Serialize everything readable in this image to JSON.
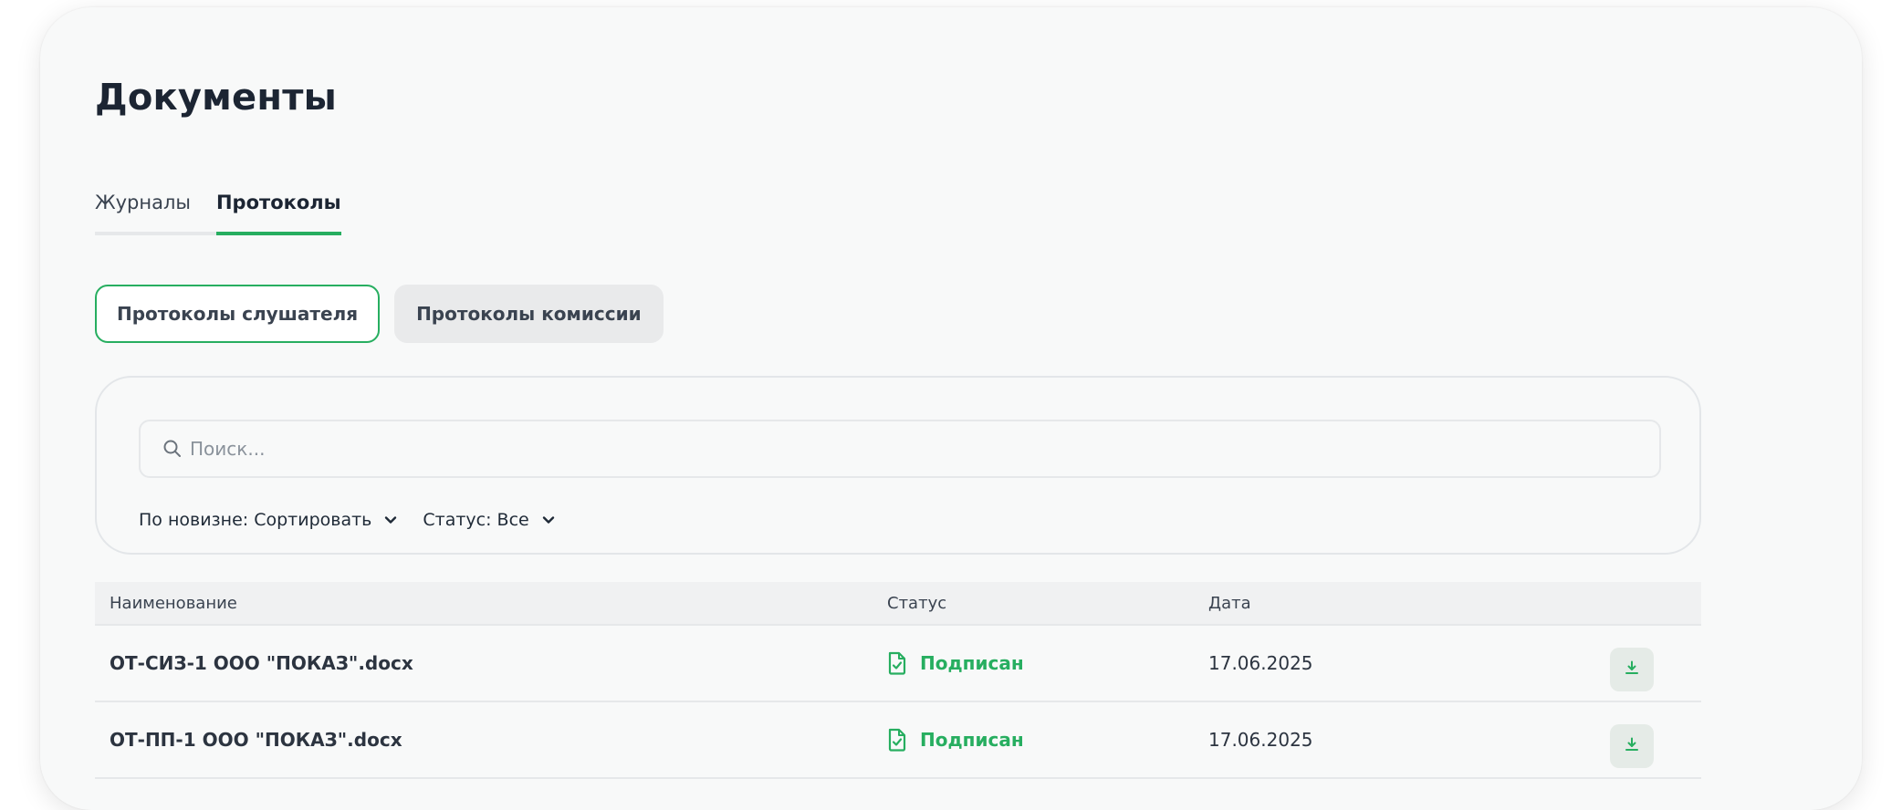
{
  "page": {
    "title": "Документы"
  },
  "tabs": [
    {
      "label": "Журналы",
      "active": false
    },
    {
      "label": "Протоколы",
      "active": true
    }
  ],
  "segments": [
    {
      "label": "Протоколы слушателя",
      "active": true
    },
    {
      "label": "Протоколы комиссии",
      "active": false
    }
  ],
  "search": {
    "placeholder": "Поиск...",
    "value": "",
    "icon": "search-icon"
  },
  "filters": {
    "sort_label": "По новизне: Сортировать",
    "status_label": "Статус: Все",
    "icon": "chevron-down-icon"
  },
  "table": {
    "headers": {
      "name": "Наименование",
      "status": "Статус",
      "date": "Дата"
    },
    "rows": [
      {
        "name": "ОТ-СИЗ-1 ООО \"ПОКАЗ\".docx",
        "status": "Подписан",
        "date": "17.06.2025"
      },
      {
        "name": "ОТ-ПП-1 ООО \"ПОКАЗ\".docx",
        "status": "Подписан",
        "date": "17.06.2025"
      }
    ]
  },
  "colors": {
    "accent": "#27ae60",
    "title": "#1c2533",
    "card_bg": "#f8f9f9",
    "download_bg": "#e5ebe7"
  }
}
